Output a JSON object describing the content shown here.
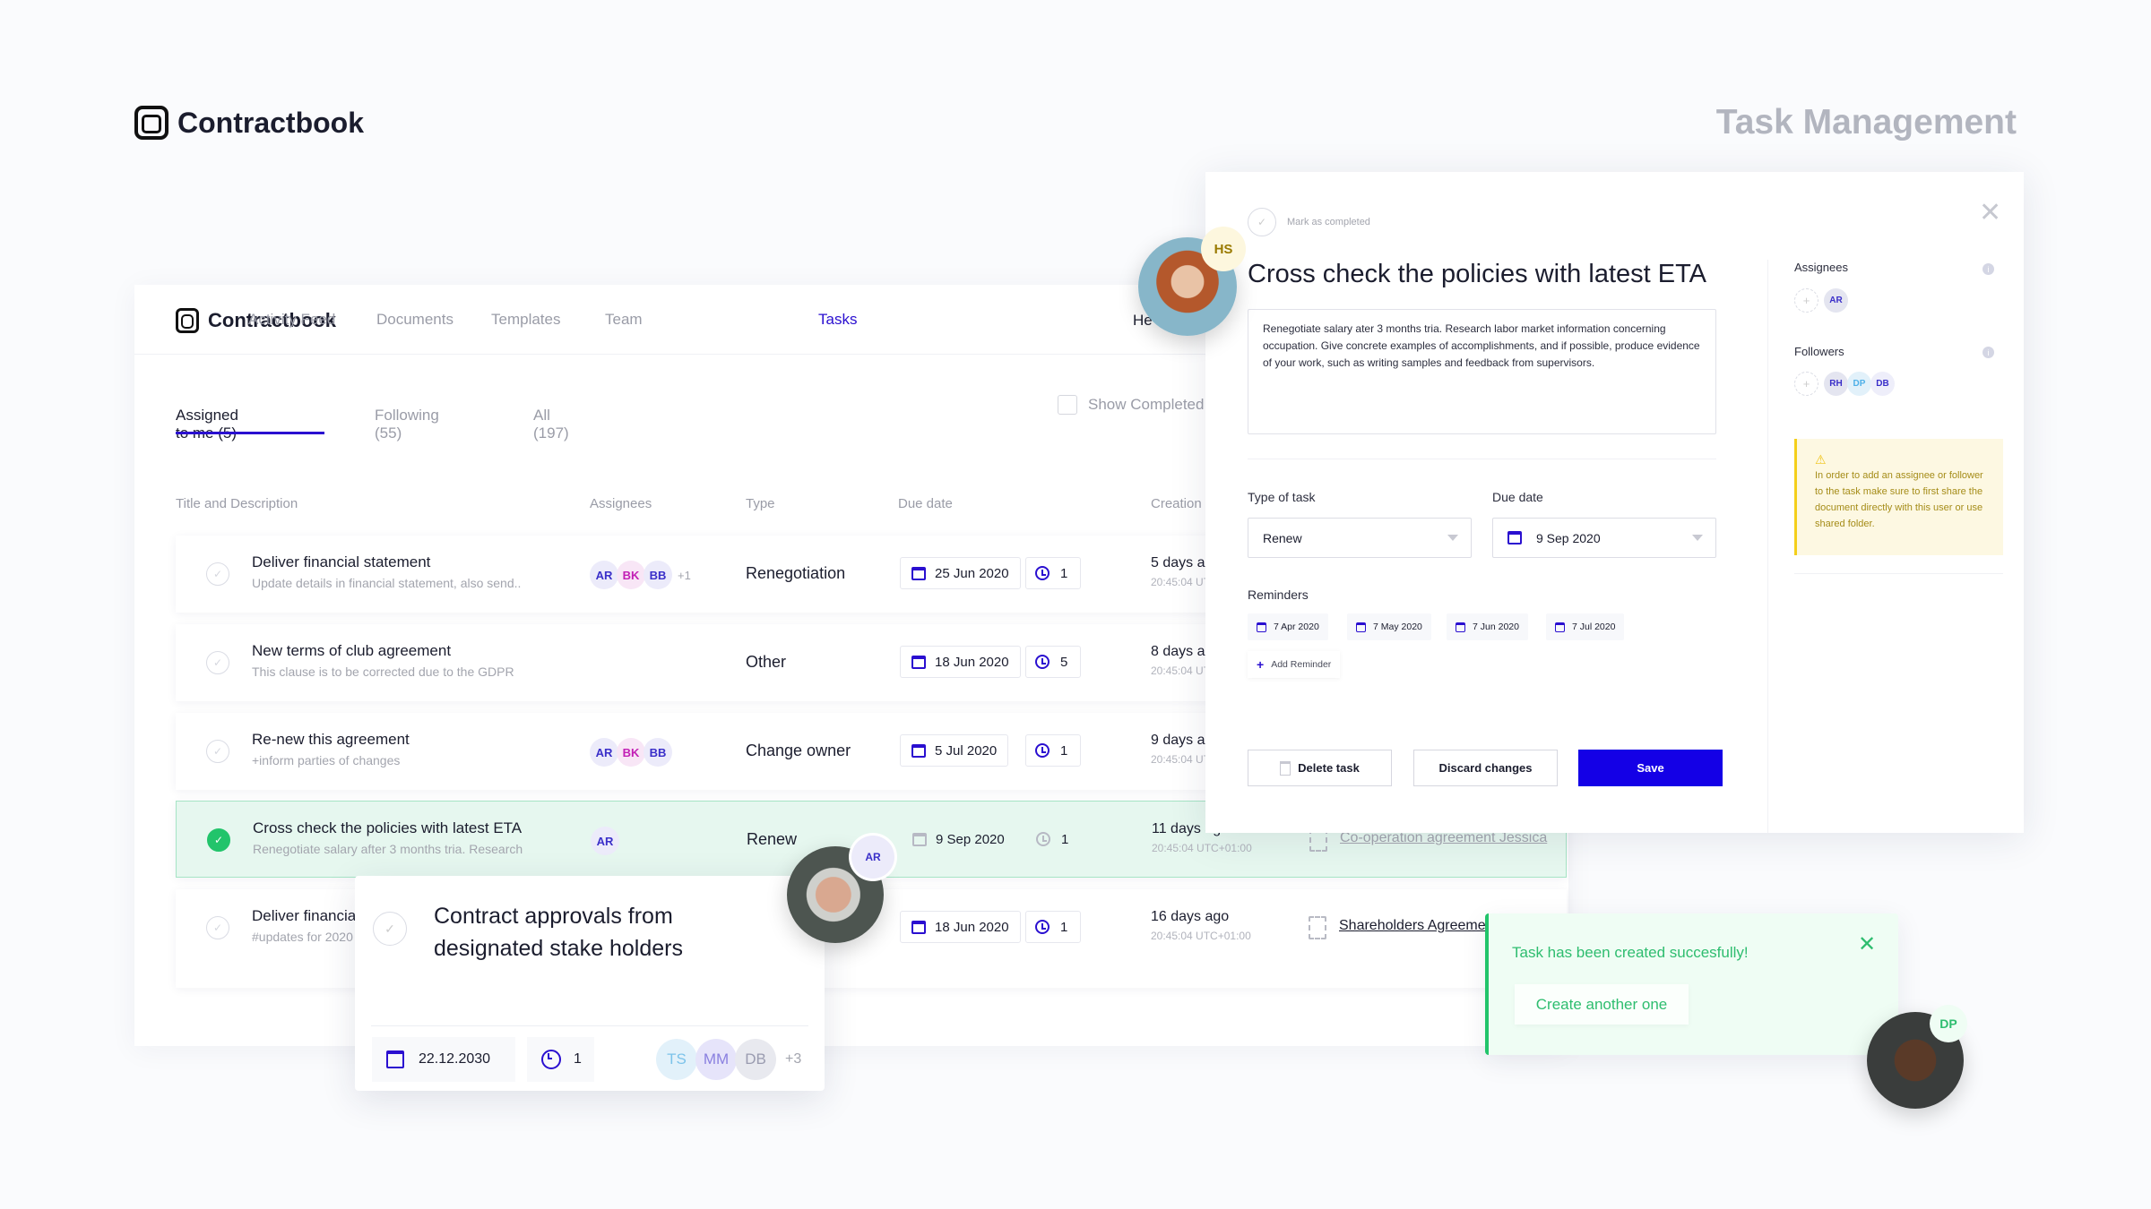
{
  "brand": {
    "name": "Contractbook"
  },
  "page_title": "Task Management",
  "nav": {
    "logo": "Contractbook",
    "items": [
      "Activity Feed",
      "Documents",
      "Templates",
      "Team",
      "Tasks"
    ],
    "active": "Tasks",
    "user_partial": "He"
  },
  "tabs": [
    {
      "label": "Assigned to me (5)",
      "active": true
    },
    {
      "label": "Following (55)"
    },
    {
      "label": "All (197)"
    }
  ],
  "show_completed": {
    "label": "Show Completed",
    "checked": false
  },
  "columns": [
    "Title and Description",
    "Assignees",
    "Type",
    "Due date",
    "Creation"
  ],
  "rows": [
    {
      "title": "Deliver financial statement",
      "desc": "Update details in financial statement, also send..",
      "assignees": [
        "AR",
        "BK",
        "BB"
      ],
      "more": "+1",
      "type": "Renegotiation",
      "due": "25 Jun 2020",
      "reminders": "1",
      "ago": "5 days ago",
      "time": "20:45:04 UTC+01:00",
      "doc": "",
      "done": false
    },
    {
      "title": "New terms of club agreement",
      "desc": "This clause is to be corrected due to the GDPR",
      "assignees": [],
      "more": "",
      "type": "Other",
      "due": "18 Jun 2020",
      "reminders": "5",
      "ago": "8 days ago",
      "time": "20:45:04 UTC+01:00",
      "doc": "",
      "done": false
    },
    {
      "title": "Re-new this agreement",
      "desc": "+inform parties of changes",
      "assignees": [
        "AR",
        "BK",
        "BB"
      ],
      "more": "",
      "type": "Change owner",
      "due": "5 Jul 2020",
      "reminders": "1",
      "ago": "9 days ago",
      "time": "20:45:04 UTC+01:00",
      "doc": "",
      "done": false
    },
    {
      "title": "Cross check the policies with latest ETA",
      "desc": "Renegotiate salary after 3 months tria. Research",
      "assignees": [
        "AR"
      ],
      "more": "",
      "type": "Renew",
      "due": "9 Sep 2020",
      "reminders": "1",
      "ago": "11 days ago",
      "time": "20:45:04 UTC+01:00",
      "doc": "Co-operation agreement Jessica",
      "done": true
    },
    {
      "title": "Deliver financial",
      "desc": "#updates for 2020",
      "assignees": [],
      "more": "",
      "type": "",
      "due": "18 Jun 2020",
      "reminders": "1",
      "ago": "16 days ago",
      "time": "20:45:04 UTC+01:00",
      "doc": "Shareholders Agreement",
      "done": false
    }
  ],
  "detail": {
    "mark_completed": "Mark as completed",
    "title": "Cross check the policies with latest ETA",
    "description": "Renegotiate salary ater 3 months tria. Research labor market information concerning occupation. Give concrete examples of accomplishments, and if possible, produce evidence of your work, such as writing samples and feedback from supervisors.",
    "type_label": "Type of task",
    "type_value": "Renew",
    "due_label": "Due date",
    "due_value": "9 Sep 2020",
    "reminders_label": "Reminders",
    "reminders": [
      "7 Apr 2020",
      "7 May 2020",
      "7 Jun 2020",
      "7 Jul 2020"
    ],
    "add_reminder": "Add Reminder",
    "delete": "Delete task",
    "discard": "Discard changes",
    "save": "Save",
    "assignees_label": "Assignees",
    "assignees": [
      "AR"
    ],
    "followers_label": "Followers",
    "followers": [
      "RH",
      "DP",
      "DB"
    ],
    "warning": "In order to add an assignee or follower to the task make sure to first share the document directly with this user or use shared folder.",
    "hs_badge": "HS"
  },
  "card": {
    "title": "Contract approvals from designated stake holders",
    "date": "22.12.2030",
    "reminders": "1",
    "avatars": [
      "TS",
      "MM",
      "DB"
    ],
    "more": "+3",
    "badge": "AR"
  },
  "toast": {
    "message": "Task has been created succesfully!",
    "action": "Create another one",
    "badge": "DP"
  },
  "colors": {
    "accent": "#2a0fd0",
    "save": "#1400e6",
    "success": "#22c46b",
    "warning": "#f4cf1a"
  }
}
